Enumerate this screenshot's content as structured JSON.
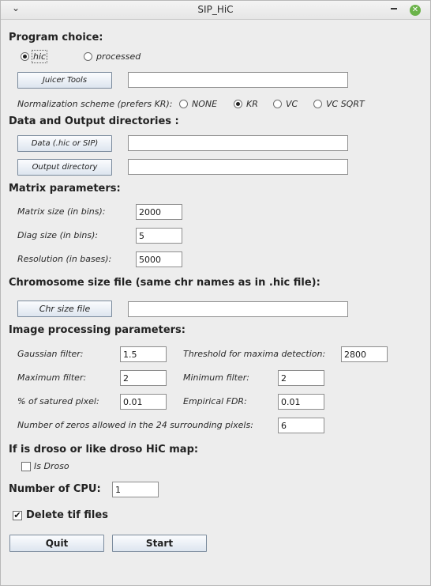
{
  "window": {
    "title": "SIP_HiC",
    "menu_glyph": "⌄",
    "close_glyph": "✕"
  },
  "program": {
    "heading": "Program choice:",
    "options": [
      "hic",
      "processed"
    ],
    "selected": "hic",
    "juicer_button": "Juicer Tools",
    "juicer_path": "",
    "norm_label": "Normalization scheme (prefers KR):",
    "norm_options": [
      "NONE",
      "KR",
      "VC",
      "VC SQRT"
    ],
    "norm_selected": "KR"
  },
  "dirs": {
    "heading": "Data and Output directories :",
    "data_button": "Data (.hic or SIP)",
    "data_path": "",
    "output_button": "Output directory",
    "output_path": ""
  },
  "matrix": {
    "heading": "Matrix parameters:",
    "size_label": "Matrix size (in bins):",
    "size_value": "2000",
    "diag_label": "Diag size (in bins):",
    "diag_value": "5",
    "res_label": "Resolution (in bases):",
    "res_value": "5000"
  },
  "chrsize": {
    "heading": "Chromosome size file (same chr names as in .hic file):",
    "button": "Chr size file",
    "path": ""
  },
  "image": {
    "heading": "Image processing parameters:",
    "gauss_label": "Gaussian filter:",
    "gauss_value": "1.5",
    "thresh_label": "Threshold for maxima detection:",
    "thresh_value": "2800",
    "max_label": "Maximum filter:",
    "max_value": "2",
    "min_label": "Minimum filter:",
    "min_value": "2",
    "sat_label": "% of satured pixel:",
    "sat_value": "0.01",
    "fdr_label": "Empirical FDR:",
    "fdr_value": "0.01",
    "zeros_label": "Number of zeros allowed in the 24 surrounding pixels:",
    "zeros_value": "6"
  },
  "droso": {
    "heading": "If is droso or like droso HiC map:",
    "check_label": "Is Droso",
    "checked": false
  },
  "cpu": {
    "label": "Number of CPU:",
    "value": "1"
  },
  "delete_tif": {
    "label": "Delete tif files",
    "checked": true
  },
  "actions": {
    "quit": "Quit",
    "start": "Start"
  }
}
